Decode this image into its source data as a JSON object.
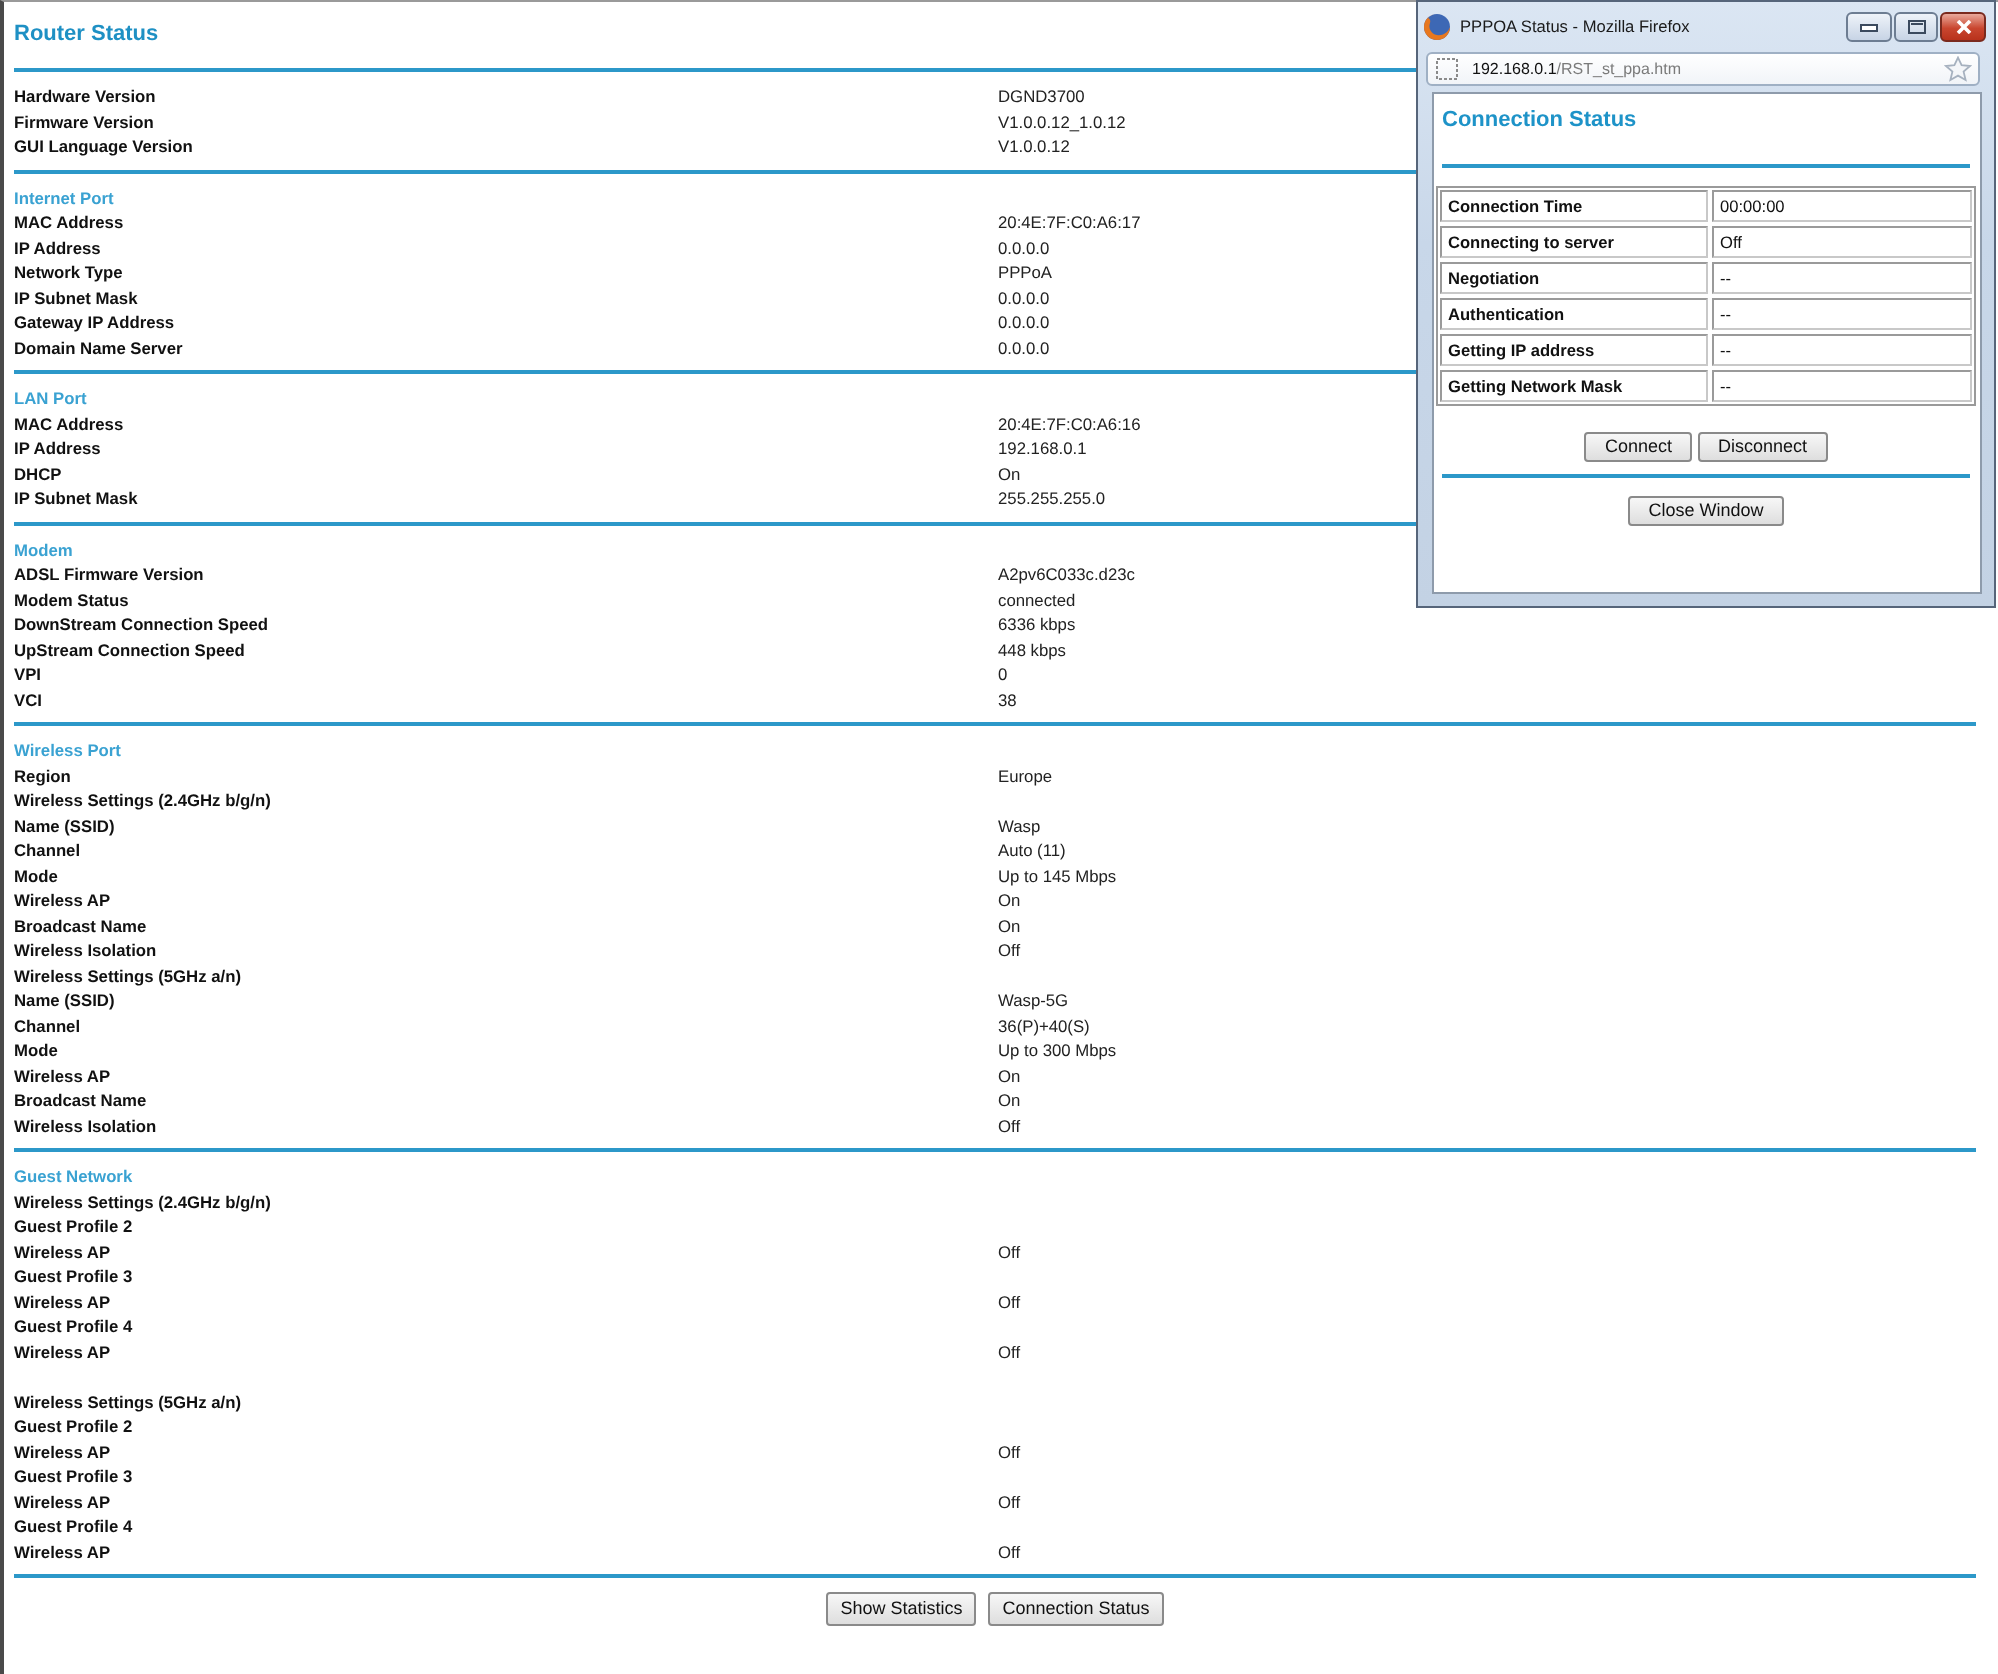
{
  "page": {
    "title": "Router Status"
  },
  "sections": [
    {
      "groups": [
        {
          "rows": [
            {
              "label": "Hardware Version",
              "value": "DGND3700"
            },
            {
              "label": "Firmware Version",
              "value": "V1.0.0.12_1.0.12"
            },
            {
              "label": "GUI Language Version",
              "value": "V1.0.0.12"
            }
          ]
        }
      ]
    },
    {
      "heading": "Internet Port",
      "groups": [
        {
          "rows": [
            {
              "label": "MAC Address",
              "value": "20:4E:7F:C0:A6:17"
            },
            {
              "label": "IP Address",
              "value": "0.0.0.0"
            },
            {
              "label": "Network Type",
              "value": "PPPoA"
            },
            {
              "label": "IP Subnet Mask",
              "value": "0.0.0.0"
            },
            {
              "label": "Gateway IP Address",
              "value": "0.0.0.0"
            },
            {
              "label": "Domain Name Server",
              "value": "0.0.0.0"
            }
          ]
        }
      ]
    },
    {
      "heading": "LAN Port",
      "groups": [
        {
          "rows": [
            {
              "label": "MAC Address",
              "value": "20:4E:7F:C0:A6:16"
            },
            {
              "label": "IP Address",
              "value": "192.168.0.1"
            },
            {
              "label": "DHCP",
              "value": "On"
            },
            {
              "label": "IP Subnet Mask",
              "value": "255.255.255.0"
            }
          ]
        }
      ]
    },
    {
      "heading": "Modem",
      "groups": [
        {
          "rows": [
            {
              "label": "ADSL Firmware Version",
              "value": "A2pv6C033c.d23c"
            },
            {
              "label": "Modem Status",
              "value": "connected"
            },
            {
              "label": "DownStream Connection Speed",
              "value": "6336 kbps"
            },
            {
              "label": "UpStream Connection Speed",
              "value": "448 kbps"
            },
            {
              "label": "VPI",
              "value": "0"
            },
            {
              "label": "VCI",
              "value": "38"
            }
          ]
        }
      ]
    },
    {
      "heading": "Wireless Port",
      "groups": [
        {
          "rows": [
            {
              "label": "Region",
              "value": "Europe"
            },
            {
              "label": "Wireless Settings (2.4GHz b/g/n)"
            },
            {
              "label": "Name (SSID)",
              "value": "Wasp"
            },
            {
              "label": "Channel",
              "value": "Auto (11)"
            },
            {
              "label": "Mode",
              "value": "Up to 145 Mbps"
            },
            {
              "label": "Wireless AP",
              "value": "On"
            },
            {
              "label": "Broadcast Name",
              "value": "On"
            },
            {
              "label": "Wireless Isolation",
              "value": "Off"
            },
            {
              "label": "Wireless Settings (5GHz a/n)"
            },
            {
              "label": "Name (SSID)",
              "value": "Wasp-5G"
            },
            {
              "label": "Channel",
              "value": "36(P)+40(S)"
            },
            {
              "label": "Mode",
              "value": "Up to 300 Mbps"
            },
            {
              "label": "Wireless AP",
              "value": "On"
            },
            {
              "label": "Broadcast Name",
              "value": "On"
            },
            {
              "label": "Wireless Isolation",
              "value": "Off"
            }
          ]
        }
      ]
    },
    {
      "heading": "Guest Network",
      "groups": [
        {
          "rows": [
            {
              "label": "Wireless Settings (2.4GHz b/g/n)"
            },
            {
              "label": "Guest Profile 2"
            },
            {
              "label": "Wireless AP",
              "value": "Off"
            },
            {
              "label": "Guest Profile 3"
            },
            {
              "label": "Wireless AP",
              "value": "Off"
            },
            {
              "label": "Guest Profile 4"
            },
            {
              "label": "Wireless AP",
              "value": "Off"
            }
          ]
        },
        {
          "rows": [
            {
              "label": "Wireless Settings (5GHz a/n)"
            },
            {
              "label": "Guest Profile 2"
            },
            {
              "label": "Wireless AP",
              "value": "Off"
            },
            {
              "label": "Guest Profile 3"
            },
            {
              "label": "Wireless AP",
              "value": "Off"
            },
            {
              "label": "Guest Profile 4"
            },
            {
              "label": "Wireless AP",
              "value": "Off"
            }
          ]
        }
      ]
    }
  ],
  "buttons": [
    {
      "label": "Show Statistics"
    },
    {
      "label": "Connection Status"
    }
  ],
  "popup": {
    "window_title": "PPPOA Status - Mozilla Firefox",
    "address": {
      "host": "192.168.0.1",
      "path": "/RST_st_ppa.htm"
    },
    "heading": "Connection Status",
    "table": [
      {
        "label": "Connection Time",
        "value": "00:00:00"
      },
      {
        "label": "Connecting to server",
        "value": "Off"
      },
      {
        "label": "Negotiation",
        "value": "--"
      },
      {
        "label": "Authentication",
        "value": "--"
      },
      {
        "label": "Getting IP address",
        "value": "--"
      },
      {
        "label": "Getting Network Mask",
        "value": "--"
      }
    ],
    "buttons": [
      {
        "label": "Connect"
      },
      {
        "label": "Disconnect"
      }
    ],
    "close_button": {
      "label": "Close Window"
    }
  }
}
